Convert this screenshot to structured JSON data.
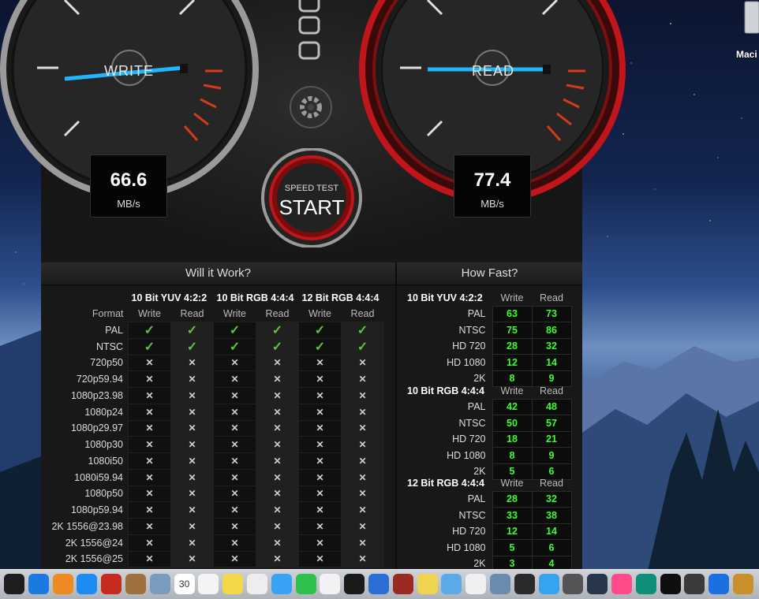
{
  "gauges": {
    "write": {
      "label": "WRITE",
      "value": "66.6",
      "unit": "MB/s"
    },
    "read": {
      "label": "READ",
      "value": "77.4",
      "unit": "MB/s"
    }
  },
  "start_button": {
    "top": "SPEED TEST",
    "main": "START"
  },
  "will_it_work": {
    "title": "Will it Work?",
    "format_header": "Format",
    "groups": [
      "10 Bit YUV 4:2:2",
      "10 Bit RGB 4:4:4",
      "12 Bit RGB 4:4:4"
    ],
    "subheaders": [
      "Write",
      "Read",
      "Write",
      "Read",
      "Write",
      "Read"
    ],
    "rows": [
      {
        "format": "PAL",
        "marks": [
          "✓",
          "✓",
          "✓",
          "✓",
          "✓",
          "✓"
        ]
      },
      {
        "format": "NTSC",
        "marks": [
          "✓",
          "✓",
          "✓",
          "✓",
          "✓",
          "✓"
        ]
      },
      {
        "format": "720p50",
        "marks": [
          "✕",
          "✕",
          "✕",
          "✕",
          "✕",
          "✕"
        ]
      },
      {
        "format": "720p59.94",
        "marks": [
          "✕",
          "✕",
          "✕",
          "✕",
          "✕",
          "✕"
        ]
      },
      {
        "format": "1080p23.98",
        "marks": [
          "✕",
          "✕",
          "✕",
          "✕",
          "✕",
          "✕"
        ]
      },
      {
        "format": "1080p24",
        "marks": [
          "✕",
          "✕",
          "✕",
          "✕",
          "✕",
          "✕"
        ]
      },
      {
        "format": "1080p29.97",
        "marks": [
          "✕",
          "✕",
          "✕",
          "✕",
          "✕",
          "✕"
        ]
      },
      {
        "format": "1080p30",
        "marks": [
          "✕",
          "✕",
          "✕",
          "✕",
          "✕",
          "✕"
        ]
      },
      {
        "format": "1080i50",
        "marks": [
          "✕",
          "✕",
          "✕",
          "✕",
          "✕",
          "✕"
        ]
      },
      {
        "format": "1080i59.94",
        "marks": [
          "✕",
          "✕",
          "✕",
          "✕",
          "✕",
          "✕"
        ]
      },
      {
        "format": "1080p50",
        "marks": [
          "✕",
          "✕",
          "✕",
          "✕",
          "✕",
          "✕"
        ]
      },
      {
        "format": "1080p59.94",
        "marks": [
          "✕",
          "✕",
          "✕",
          "✕",
          "✕",
          "✕"
        ]
      },
      {
        "format": "2K 1556@23.98",
        "marks": [
          "✕",
          "✕",
          "✕",
          "✕",
          "✕",
          "✕"
        ]
      },
      {
        "format": "2K 1556@24",
        "marks": [
          "✕",
          "✕",
          "✕",
          "✕",
          "✕",
          "✕"
        ]
      },
      {
        "format": "2K 1556@25",
        "marks": [
          "✕",
          "✕",
          "✕",
          "✕",
          "✕",
          "✕"
        ]
      }
    ]
  },
  "how_fast": {
    "title": "How Fast?",
    "write_label": "Write",
    "read_label": "Read",
    "groups": [
      {
        "name": "10 Bit YUV 4:2:2",
        "rows": [
          {
            "format": "PAL",
            "write": "63",
            "read": "73"
          },
          {
            "format": "NTSC",
            "write": "75",
            "read": "86"
          },
          {
            "format": "HD 720",
            "write": "28",
            "read": "32"
          },
          {
            "format": "HD 1080",
            "write": "12",
            "read": "14"
          },
          {
            "format": "2K",
            "write": "8",
            "read": "9"
          }
        ]
      },
      {
        "name": "10 Bit RGB 4:4:4",
        "rows": [
          {
            "format": "PAL",
            "write": "42",
            "read": "48"
          },
          {
            "format": "NTSC",
            "write": "50",
            "read": "57"
          },
          {
            "format": "HD 720",
            "write": "18",
            "read": "21"
          },
          {
            "format": "HD 1080",
            "write": "8",
            "read": "9"
          },
          {
            "format": "2K",
            "write": "5",
            "read": "6"
          }
        ]
      },
      {
        "name": "12 Bit RGB 4:4:4",
        "rows": [
          {
            "format": "PAL",
            "write": "28",
            "read": "32"
          },
          {
            "format": "NTSC",
            "write": "33",
            "read": "38"
          },
          {
            "format": "HD 720",
            "write": "12",
            "read": "14"
          },
          {
            "format": "HD 1080",
            "write": "5",
            "read": "6"
          },
          {
            "format": "2K",
            "write": "3",
            "read": "4"
          }
        ]
      }
    ]
  },
  "desktop": {
    "drive_label": "Maci"
  },
  "dock": {
    "calendar_day": "30",
    "icons": [
      "activity-monitor",
      "safari",
      "books",
      "app-store",
      "photo-booth",
      "notes-brown",
      "preview",
      "calendar",
      "reminders",
      "stickies",
      "textedit",
      "messages",
      "facetime",
      "photos",
      "terminal",
      "mission-control",
      "dictionary",
      "stickies-yellow",
      "finder-folder",
      "script",
      "image-capture",
      "battery",
      "wifi",
      "calculator",
      "dvd",
      "itunes",
      "time-machine",
      "dashboard",
      "bear",
      "malwarebytes",
      "reaper"
    ]
  },
  "colors": {
    "accent_needle": "#1fb6ff",
    "green_value": "#39ff2a",
    "check": "#5ec43a",
    "read_ring": "#c0151b"
  }
}
